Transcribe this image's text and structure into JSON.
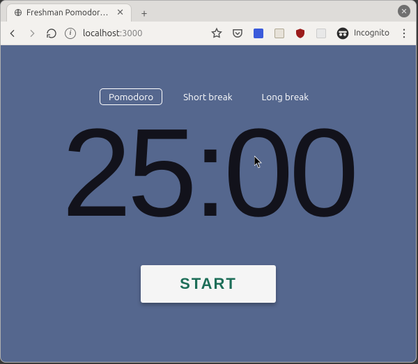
{
  "browser": {
    "tab_title": "Freshman Pomodoro Cloc",
    "url_host": "localhost",
    "url_port": ":3000",
    "incognito_label": "Incognito"
  },
  "modes": {
    "pomodoro": "Pomodoro",
    "short_break": "Short break",
    "long_break": "Long break"
  },
  "timer": {
    "display": "25:00"
  },
  "controls": {
    "start": "START"
  }
}
